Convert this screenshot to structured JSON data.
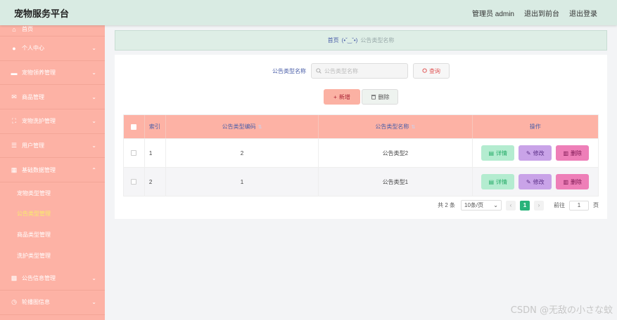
{
  "app": {
    "title": "宠物服务平台"
  },
  "header": {
    "links": [
      "管理员 admin",
      "退出到前台",
      "退出登录"
    ]
  },
  "sidebar": {
    "items": [
      {
        "label": "首页",
        "icon": "home-icon",
        "glyph": "⌂"
      },
      {
        "label": "个人中心",
        "icon": "user-icon",
        "glyph": "●",
        "chevron": "⌄"
      },
      {
        "label": "宠物领养管理",
        "icon": "briefcase-icon",
        "glyph": "▬",
        "chevron": "⌄"
      },
      {
        "label": "商品管理",
        "icon": "mail-icon",
        "glyph": "✉",
        "chevron": "⌄"
      },
      {
        "label": "宠物洗护管理",
        "icon": "fullscreen-icon",
        "glyph": "⛶",
        "chevron": "⌄"
      },
      {
        "label": "用户管理",
        "icon": "sliders-icon",
        "glyph": "☰",
        "chevron": "⌄"
      },
      {
        "label": "基础数据管理",
        "icon": "clipboard-icon",
        "glyph": "▦",
        "chevron": "⌃"
      }
    ],
    "sub_items": [
      {
        "label": "宠物类型管理",
        "active": false
      },
      {
        "label": "公告类型管理",
        "active": true
      },
      {
        "label": "商品类型管理",
        "active": false
      },
      {
        "label": "洗护类型管理",
        "active": false
      }
    ],
    "bottom_items": [
      {
        "label": "公告信息管理",
        "icon": "ticket-icon",
        "glyph": "▩",
        "chevron": "⌄"
      },
      {
        "label": "轮播图信息",
        "icon": "clock-icon",
        "glyph": "◷",
        "chevron": "⌄"
      }
    ]
  },
  "breadcrumb": {
    "home": "首页",
    "face": "(•ˇ‿ˇ•)",
    "current": "公告类型名称"
  },
  "search": {
    "label": "公告类型名称",
    "placeholder": "公告类型名称",
    "value": "",
    "button": "查询"
  },
  "actions": {
    "add": "新增",
    "delete": "删除"
  },
  "table": {
    "headers": [
      "索引",
      "公告类型编码",
      "公告类型名称",
      "操作"
    ],
    "rows": [
      {
        "index": "1",
        "code": "2",
        "name": "公告类型2"
      },
      {
        "index": "2",
        "code": "1",
        "name": "公告类型1"
      }
    ],
    "row_actions": {
      "detail": "详情",
      "edit": "修改",
      "delete": "删除"
    }
  },
  "pagination": {
    "total": "共 2 条",
    "page_size": "10条/页",
    "current_page": "1",
    "goto_label": "前往",
    "goto_value": "1",
    "page_suffix": "页"
  },
  "watermark": "CSDN @无敌の小さな蚊",
  "colors": {
    "topbar": "#d9ebe3",
    "sidebar": "#fdb2a5",
    "active_sub": "#f7ee6a",
    "detail": "#b4ecd0",
    "edit": "#c9a3e8",
    "delete": "#ee7fb8",
    "page_active": "#29b37a"
  }
}
